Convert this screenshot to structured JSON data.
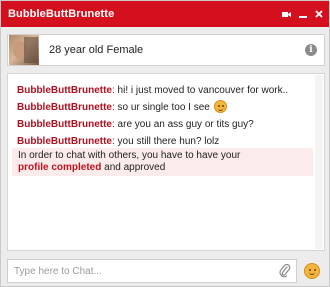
{
  "window": {
    "title": "BubbleButtBrunette",
    "accent_color": "#d4101e",
    "controls": [
      {
        "name": "video-camera-icon"
      },
      {
        "name": "minimize-icon"
      },
      {
        "name": "close-icon"
      }
    ]
  },
  "profile": {
    "description": "28 year old Female",
    "info_icon_label": "i"
  },
  "messages": [
    {
      "sender": "BubbleButtBrunette",
      "text": " hi! i just moved to vancouver for work..",
      "emoji": false
    },
    {
      "sender": "BubbleButtBrunette",
      "text": " so ur single too I see",
      "emoji": true
    },
    {
      "sender": "BubbleButtBrunette",
      "text": " are you an ass guy or tits guy?",
      "emoji": false
    },
    {
      "sender": "BubbleButtBrunette",
      "text": " you still there hun? lolz",
      "emoji": false
    }
  ],
  "notice": {
    "line1": "In order to chat with others, you have to have your",
    "link": "profile completed",
    "line2_tail": " and approved"
  },
  "composer": {
    "placeholder": "Type here to Chat...",
    "attach_icon": "paperclip-icon",
    "emoji_icon": "smiley-icon"
  }
}
